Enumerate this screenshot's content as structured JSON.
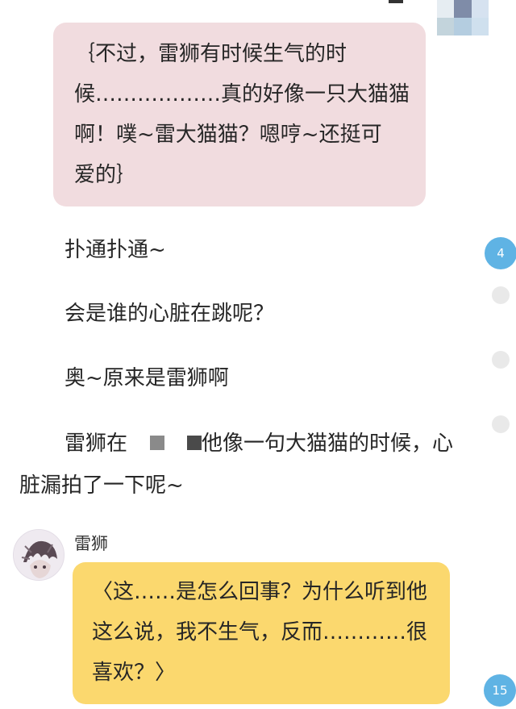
{
  "pink_bubble": {
    "lines": [
      "｛不过，雷狮有时候生气的时",
      "候………………真的好像一只大猫猫",
      "啊！噗~雷大猫猫？嗯哼~还挺可",
      "爱的｝"
    ]
  },
  "narration": {
    "line1": "扑通扑通~",
    "line2": "会是谁的心脏在跳呢？",
    "line3": "奥~原来是雷狮啊",
    "line4_prefix": "雷狮在",
    "line4_suffix": "他像一句大猫猫的时候，心",
    "line5": "脏漏拍了一下呢~"
  },
  "side_markers": {
    "badge_top": "4",
    "badge_bottom": "15"
  },
  "sender": {
    "name": "雷狮"
  },
  "yellow_bubble": {
    "lines": [
      "〈这……是怎么回事？为什么听到他",
      "这么说，我不生气，反而…………很",
      "喜欢？〉"
    ]
  },
  "colors": {
    "pink_bubble": "#f1dcdf",
    "yellow_bubble": "#fbd86e",
    "badge": "#5fb3e4",
    "dot": "#e9e9e9"
  }
}
